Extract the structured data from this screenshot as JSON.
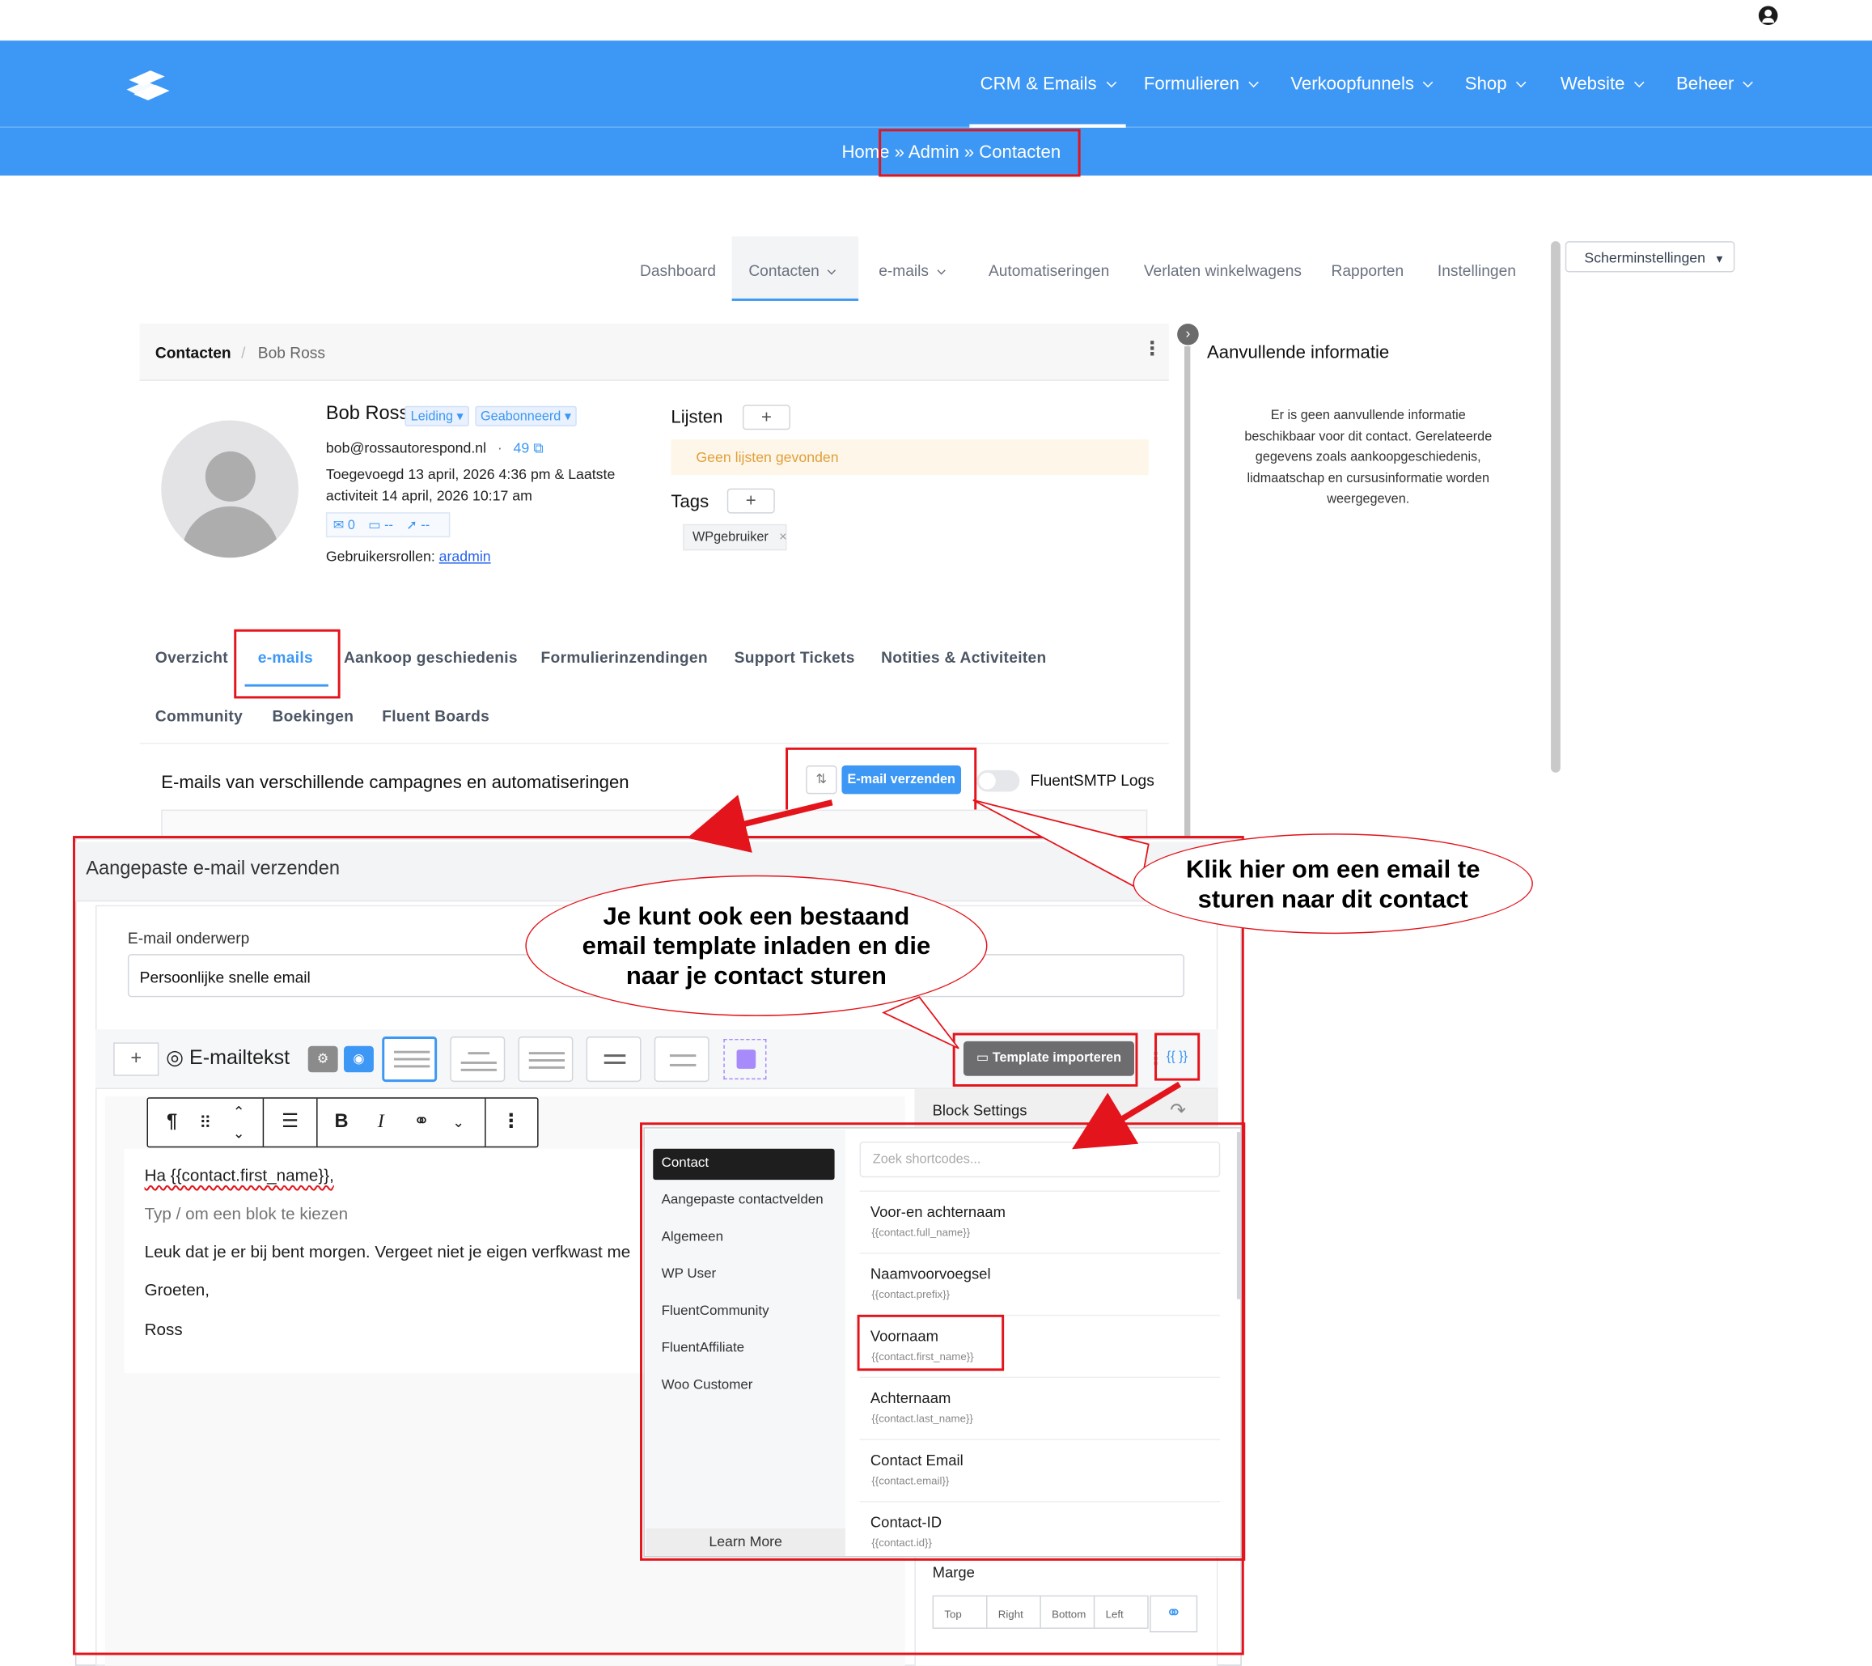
{
  "topnav": {
    "items": [
      "CRM & Emails",
      "Formulieren",
      "Verkoopfunnels",
      "Shop",
      "Website",
      "Beheer"
    ]
  },
  "breadcrumb": {
    "text": "Home » Admin » Contacten"
  },
  "subnav": {
    "items": [
      "Dashboard",
      "Contacten",
      "e-mails",
      "Automatiseringen",
      "Verlaten winkelwagens",
      "Rapporten",
      "Instellingen"
    ],
    "screen_settings": "Scherminstellingen"
  },
  "contact_crumb": {
    "parent": "Contacten",
    "sep": "/",
    "current": "Bob Ross"
  },
  "contact": {
    "name": "Bob Ross",
    "badge_status": "Leiding",
    "badge_sub": "Geabonneerd",
    "email": "bob@rossautorespond.nl",
    "id_link": "49",
    "added_line1": "Toegevoegd 13 april, 2026 4:36 pm & Laatste",
    "added_line2": "activiteit 14 april, 2026 10:17 am",
    "stat_mail": "0",
    "stat_folder": "--",
    "stat_send": "--",
    "roles_label": "Gebruikersrollen:",
    "roles_value": "aradmin"
  },
  "lists": {
    "title": "Lijsten",
    "empty": "Geen lijsten gevonden",
    "plus": "+"
  },
  "tags": {
    "title": "Tags",
    "items": [
      "WPgebruiker"
    ],
    "plus": "+",
    "remove": "×"
  },
  "aside": {
    "title": "Aanvullende informatie",
    "body_lines": [
      "Er is geen aanvullende informatie",
      "beschikbaar voor dit contact. Gerelateerde",
      "gegevens zoals aankoopgeschiedenis,",
      "lidmaatschap en cursusinformatie worden",
      "weergegeven."
    ]
  },
  "contact_tabs": {
    "row1": [
      "Overzicht",
      "e-mails",
      "Aankoop geschiedenis",
      "Formulierinzendingen",
      "Support Tickets",
      "Notities & Activiteiten"
    ],
    "row2": [
      "Community",
      "Boekingen",
      "Fluent Boards"
    ]
  },
  "emails_section": {
    "heading": "E-mails van verschillende campagnes en automatiseringen",
    "send_button": "E-mail verzenden",
    "logs_label": "FluentSMTP Logs"
  },
  "modal": {
    "title": "Aangepaste e-mail verzenden",
    "subject_label": "E-mail onderwerp",
    "subject_value": "Persoonlijke snelle email",
    "body_label": "E-mailtekst",
    "import_button": "Template importeren",
    "shortcode_button": "{{ }}",
    "block_settings": "Block Settings",
    "editor_lines": [
      "Ha {{contact.first_name}},",
      "Typ / om een blok te kiezen",
      "Leuk dat je er bij bent morgen. Vergeet niet je eigen verfkwast me",
      "Groeten,",
      "Ross"
    ],
    "margin_label": "Marge",
    "margin_fields": [
      "Top",
      "Right",
      "Bottom",
      "Left"
    ]
  },
  "shortcodes": {
    "search_placeholder": "Zoek shortcodes...",
    "categories": [
      "Contact",
      "Aangepaste contactvelden",
      "Algemeen",
      "WP User",
      "FluentCommunity",
      "FluentAffiliate",
      "Woo Customer"
    ],
    "learn_more": "Learn More",
    "items": [
      {
        "name": "Voor-en achternaam",
        "code": "{{contact.full_name}}"
      },
      {
        "name": "Naamvoorvoegsel",
        "code": "{{contact.prefix}}"
      },
      {
        "name": "Voornaam",
        "code": "{{contact.first_name}}"
      },
      {
        "name": "Achternaam",
        "code": "{{contact.last_name}}"
      },
      {
        "name": "Contact Email",
        "code": "{{contact.email}}"
      },
      {
        "name": "Contact-ID",
        "code": "{{contact.id}}"
      }
    ]
  },
  "callouts": {
    "right": [
      "Klik hier om een email te",
      "sturen naar dit contact"
    ],
    "left": [
      "Je kunt ook een bestaand",
      "email template inladen en die",
      "naar je contact sturen"
    ]
  },
  "colors": {
    "primary": "#3d97f4",
    "highlight": "#e3141b",
    "dark": "#1e1e1e"
  }
}
